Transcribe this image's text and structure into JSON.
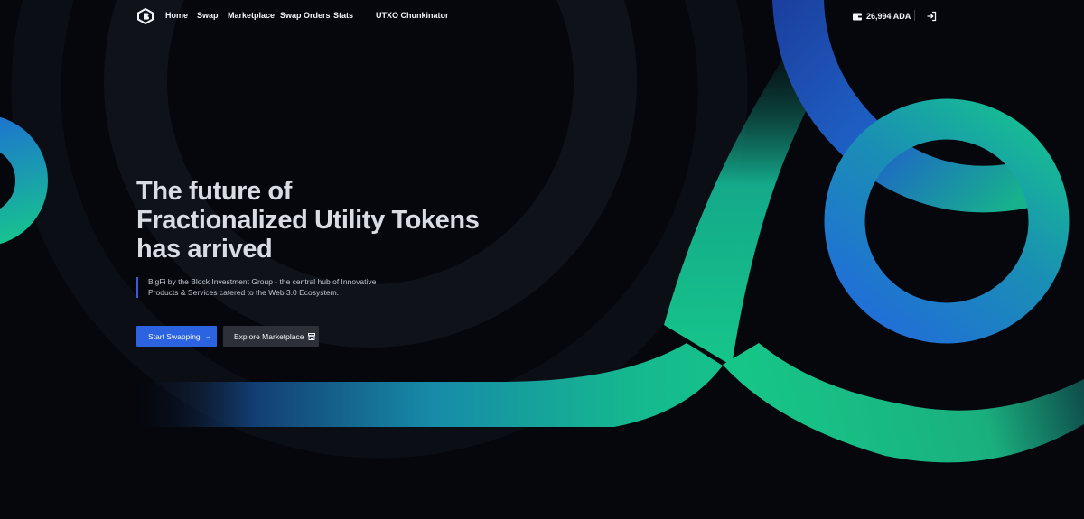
{
  "nav": {
    "links": [
      "Home",
      "Swap",
      "Marketplace",
      "Swap Orders",
      "Stats",
      "UTXO Chunkinator"
    ],
    "wallet_balance": "26,994 ADA"
  },
  "hero": {
    "title_lines": [
      "The future of",
      "Fractionalized Utility Tokens",
      "has arrived"
    ],
    "description": "BigFi by the Block Investment Group - the central hub of Innovative Products & Services catered to the Web 3.0 Ecosystem."
  },
  "buttons": {
    "primary": "Start Swapping",
    "secondary": "Explore Marketplace"
  },
  "colors": {
    "background": "#05070d",
    "accent_blue": "#2b63e0",
    "accent_green": "#16c88a"
  }
}
